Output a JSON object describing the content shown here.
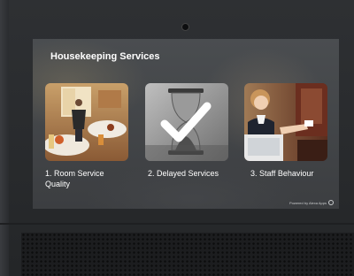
{
  "screen": {
    "title": "Housekeeping Services",
    "powered_by": "Powered by Alexa Apps"
  },
  "cards": [
    {
      "label": "1. Room Service Quality",
      "image": "room-service-photo"
    },
    {
      "label": "2. Delayed Services",
      "image": "hourglass-checkmark-photo",
      "selected": true
    },
    {
      "label": "3. Staff Behaviour",
      "image": "staff-receptionist-photo"
    }
  ],
  "colors": {
    "bezel": "#2b2d30",
    "screen_background": "#45484b",
    "text": "#ffffff",
    "check": "#ffffff"
  }
}
